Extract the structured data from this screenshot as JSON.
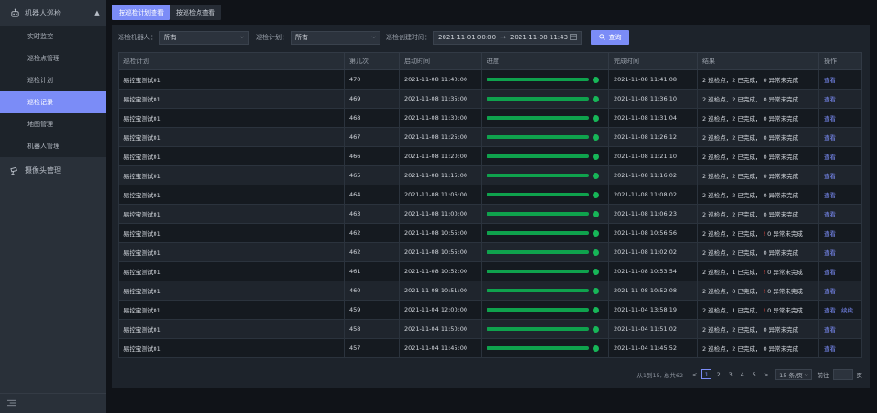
{
  "sidebar": {
    "group1": {
      "label": "机器人巡检",
      "icon": "robot-icon"
    },
    "items": [
      {
        "label": "实时监控"
      },
      {
        "label": "巡检点管理"
      },
      {
        "label": "巡检计划"
      },
      {
        "label": "巡检记录",
        "active": true
      },
      {
        "label": "地图管理"
      },
      {
        "label": "机器人管理"
      }
    ],
    "group2": {
      "label": "摄像头管理",
      "icon": "camera-icon"
    }
  },
  "tabs": [
    {
      "label": "按巡检计划查看",
      "active": true
    },
    {
      "label": "按巡检点查看",
      "active": false
    }
  ],
  "filters": {
    "robot_label": "巡检机器人：",
    "robot_value": "所有",
    "plan_label": "巡检计划：",
    "plan_value": "所有",
    "date_label": "巡检创建时间：",
    "date_start": "2021-11-01 00:00",
    "date_sep": "→",
    "date_end": "2021-11-08 11:43",
    "search_label": "查询"
  },
  "table": {
    "headers": [
      "巡检计划",
      "第几次",
      "启动时间",
      "进度",
      "完成时间",
      "结果",
      "操作"
    ],
    "rows": [
      {
        "plan": "易控宝测试01",
        "num": "470",
        "start": "2021-11-08 11:40:00",
        "end": "2021-11-08 11:41:08",
        "r1": "2 巡检点，2 已完成，",
        "bang": "",
        "r2": "0 异常未完成",
        "a1": "查看",
        "a2": ""
      },
      {
        "plan": "易控宝测试01",
        "num": "469",
        "start": "2021-11-08 11:35:00",
        "end": "2021-11-08 11:36:10",
        "r1": "2 巡检点，2 已完成，",
        "bang": "",
        "r2": "0 异常未完成",
        "a1": "查看",
        "a2": ""
      },
      {
        "plan": "易控宝测试01",
        "num": "468",
        "start": "2021-11-08 11:30:00",
        "end": "2021-11-08 11:31:04",
        "r1": "2 巡检点，2 已完成，",
        "bang": "",
        "r2": "0 异常未完成",
        "a1": "查看",
        "a2": ""
      },
      {
        "plan": "易控宝测试01",
        "num": "467",
        "start": "2021-11-08 11:25:00",
        "end": "2021-11-08 11:26:12",
        "r1": "2 巡检点，2 已完成，",
        "bang": "",
        "r2": "0 异常未完成",
        "a1": "查看",
        "a2": ""
      },
      {
        "plan": "易控宝测试01",
        "num": "466",
        "start": "2021-11-08 11:20:00",
        "end": "2021-11-08 11:21:10",
        "r1": "2 巡检点，2 已完成，",
        "bang": "",
        "r2": "0 异常未完成",
        "a1": "查看",
        "a2": ""
      },
      {
        "plan": "易控宝测试01",
        "num": "465",
        "start": "2021-11-08 11:15:00",
        "end": "2021-11-08 11:16:02",
        "r1": "2 巡检点，2 已完成，",
        "bang": "",
        "r2": "0 异常未完成",
        "a1": "查看",
        "a2": ""
      },
      {
        "plan": "易控宝测试01",
        "num": "464",
        "start": "2021-11-08 11:06:00",
        "end": "2021-11-08 11:08:02",
        "r1": "2 巡检点，2 已完成，",
        "bang": "",
        "r2": "0 异常未完成",
        "a1": "查看",
        "a2": ""
      },
      {
        "plan": "易控宝测试01",
        "num": "463",
        "start": "2021-11-08 11:00:00",
        "end": "2021-11-08 11:06:23",
        "r1": "2 巡检点，2 已完成，",
        "bang": "",
        "r2": "0 异常未完成",
        "a1": "查看",
        "a2": ""
      },
      {
        "plan": "易控宝测试01",
        "num": "462",
        "start": "2021-11-08 10:55:00",
        "end": "2021-11-08 10:56:56",
        "r1": "2 巡检点，2 已完成，",
        "bang": "!",
        "r2": "0 异常未完成",
        "a1": "查看",
        "a2": ""
      },
      {
        "plan": "易控宝测试01",
        "num": "462",
        "start": "2021-11-08 10:55:00",
        "end": "2021-11-08 11:02:02",
        "r1": "2 巡检点，2 已完成，",
        "bang": "",
        "r2": "0 异常未完成",
        "a1": "查看",
        "a2": ""
      },
      {
        "plan": "易控宝测试01",
        "num": "461",
        "start": "2021-11-08 10:52:00",
        "end": "2021-11-08 10:53:54",
        "r1": "2 巡检点，1 已完成，",
        "bang": "!",
        "r2": "0 异常未完成",
        "a1": "查看",
        "a2": ""
      },
      {
        "plan": "易控宝测试01",
        "num": "460",
        "start": "2021-11-08 10:51:00",
        "end": "2021-11-08 10:52:08",
        "r1": "2 巡检点，0 已完成，",
        "bang": "!",
        "r2": "0 异常未完成",
        "a1": "查看",
        "a2": ""
      },
      {
        "plan": "易控宝测试01",
        "num": "459",
        "start": "2021-11-04 12:00:00",
        "end": "2021-11-04 13:58:19",
        "r1": "2 巡检点，1 已完成，",
        "bang": "!",
        "r2": "0 异常未完成",
        "a1": "查看",
        "a2": "续续"
      },
      {
        "plan": "易控宝测试01",
        "num": "458",
        "start": "2021-11-04 11:50:00",
        "end": "2021-11-04 11:51:02",
        "r1": "2 巡检点，2 已完成，",
        "bang": "",
        "r2": "0 异常未完成",
        "a1": "查看",
        "a2": ""
      },
      {
        "plan": "易控宝测试01",
        "num": "457",
        "start": "2021-11-04 11:45:00",
        "end": "2021-11-04 11:45:52",
        "r1": "2 巡检点，2 已完成，",
        "bang": "",
        "r2": "0 异常未完成",
        "a1": "查看",
        "a2": ""
      }
    ]
  },
  "pager": {
    "total": "从1到15, 总共62",
    "prev": "<",
    "pages": [
      "1",
      "2",
      "3",
      "4",
      "5"
    ],
    "next": ">",
    "size": "15 条/页",
    "goto_label": "前往",
    "goto_suffix": "页"
  },
  "colors": {
    "accent": "#7b8cf7",
    "progress": "#0fa24d",
    "warn": "#e0463b"
  }
}
